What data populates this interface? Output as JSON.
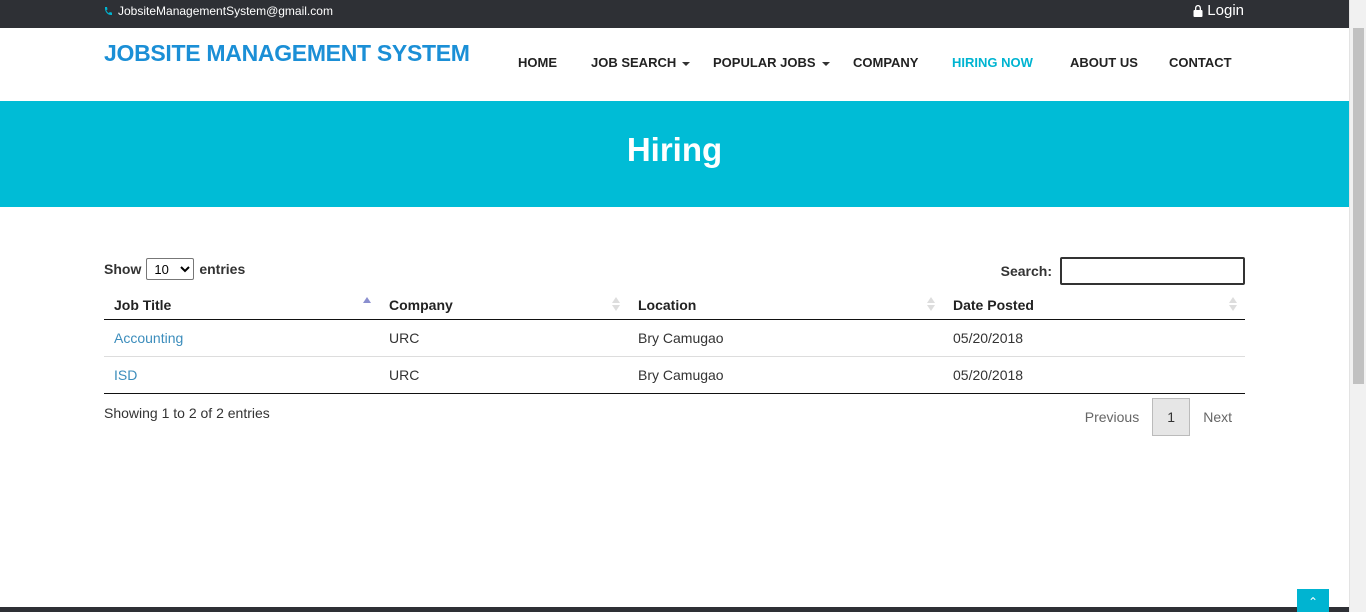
{
  "topbar": {
    "email": "JobsiteManagementSystem@gmail.com",
    "login_label": "Login"
  },
  "header": {
    "brand": "JOBSITE MANAGEMENT SYSTEM",
    "nav": [
      {
        "label": "HOME",
        "dropdown": false,
        "active": false
      },
      {
        "label": "JOB SEARCH",
        "dropdown": true,
        "active": false
      },
      {
        "label": "POPULAR JOBS",
        "dropdown": true,
        "active": false
      },
      {
        "label": "COMPANY",
        "dropdown": false,
        "active": false
      },
      {
        "label": "HIRING NOW",
        "dropdown": false,
        "active": true
      },
      {
        "label": "ABOUT US",
        "dropdown": false,
        "active": false
      },
      {
        "label": "CONTACT",
        "dropdown": false,
        "active": false
      }
    ]
  },
  "hero": {
    "title": "Hiring"
  },
  "table_controls": {
    "show_label": "Show",
    "entries_label": "entries",
    "page_size": "10",
    "search_label": "Search:",
    "search_value": ""
  },
  "table": {
    "columns": [
      "Job Title",
      "Company",
      "Location",
      "Date Posted"
    ],
    "rows": [
      {
        "job_title": "Accounting",
        "company": "URC",
        "location": "Bry Camugao",
        "date_posted": "05/20/2018"
      },
      {
        "job_title": "ISD",
        "company": "URC",
        "location": "Bry Camugao",
        "date_posted": "05/20/2018"
      }
    ]
  },
  "footer_info": {
    "showing": "Showing 1 to 2 of 2 entries",
    "previous": "Previous",
    "current_page": "1",
    "next": "Next"
  },
  "colors": {
    "accent": "#00bcd6",
    "brand": "#1b8fd6",
    "link": "#3c8dbc",
    "topbar": "#2e3035"
  },
  "icons": {
    "phone": "phone-icon",
    "lock": "lock-icon",
    "to_top": "chevron-up-icon"
  }
}
